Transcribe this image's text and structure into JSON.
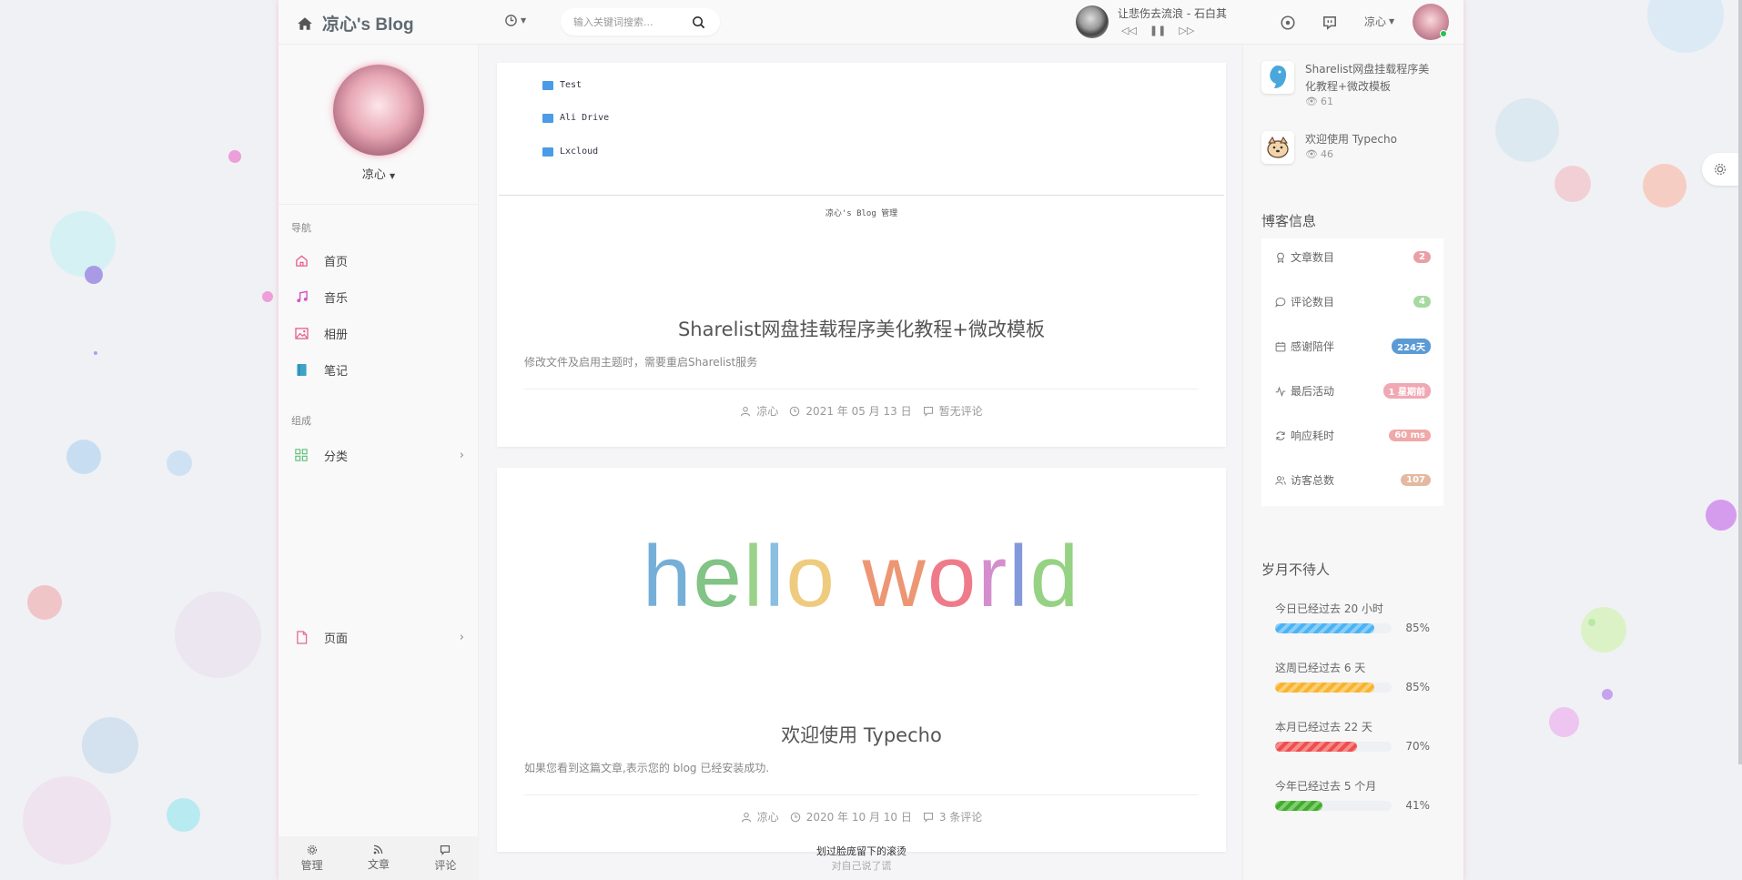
{
  "header": {
    "brand": "凉心's Blog",
    "search_placeholder": "输入关键词搜索...",
    "song": "让悲伤去流浪 - 石白其",
    "user": "凉心"
  },
  "sidebar": {
    "profile_name": "凉心",
    "nav_heading": "导航",
    "nav": [
      "首页",
      "音乐",
      "相册",
      "笔记"
    ],
    "group_heading": "组成",
    "category": "分类",
    "pages": "页面",
    "footer": [
      "管理",
      "文章",
      "评论"
    ]
  },
  "posts": [
    {
      "screenshot": {
        "folders": [
          "Test",
          "Ali Drive",
          "Lxcloud"
        ],
        "footer": "凉心's Blog  管理"
      },
      "title": "Sharelist网盘挂载程序美化教程+微改模板",
      "excerpt": "修改文件及启用主题时，需要重启Sharelist服务",
      "author": "凉心",
      "date": "2021 年 05 月 13 日",
      "comments": "暂无评论"
    },
    {
      "image_text": "hello world",
      "title": "欢迎使用 Typecho",
      "excerpt": "如果您看到这篇文章,表示您的 blog 已经安装成功.",
      "author": "凉心",
      "date": "2020 年 10 月 10 日",
      "comments": "3 条评论"
    }
  ],
  "footer": {
    "line1": "划过脸庞留下的滚烫",
    "line2": "对自己说了谎"
  },
  "right": {
    "hot": [
      {
        "title": "Sharelist网盘挂载程序美化教程+微改模板",
        "views": "61"
      },
      {
        "title": "欢迎使用 Typecho",
        "views": "46"
      }
    ],
    "info_title": "博客信息",
    "info": [
      {
        "label": "文章数目",
        "value": "2",
        "color": "#e8a0a6"
      },
      {
        "label": "评论数目",
        "value": "4",
        "color": "#a6d9a0"
      },
      {
        "label": "感谢陪伴",
        "value": "224天",
        "color": "#5b9bd5"
      },
      {
        "label": "最后活动",
        "value": "1 星期前",
        "color": "#f0a8b4"
      },
      {
        "label": "响应耗时",
        "value": "60 ms",
        "color": "#f0a8a8"
      },
      {
        "label": "访客总数",
        "value": "107",
        "color": "#e3b9a0"
      }
    ],
    "time_title": "岁月不待人",
    "progress": [
      {
        "label": "今日已经过去 20 小时",
        "pct": "85%",
        "value": 0.85,
        "color": "#4ab3f4"
      },
      {
        "label": "这周已经过去 6 天",
        "pct": "85%",
        "value": 0.85,
        "color": "#f7b42c"
      },
      {
        "label": "本月已经过去 22 天",
        "pct": "70%",
        "value": 0.7,
        "color": "#ef4e4e"
      },
      {
        "label": "今年已经过去 5 个月",
        "pct": "41%",
        "value": 0.41,
        "color": "#3fae2a"
      }
    ]
  }
}
